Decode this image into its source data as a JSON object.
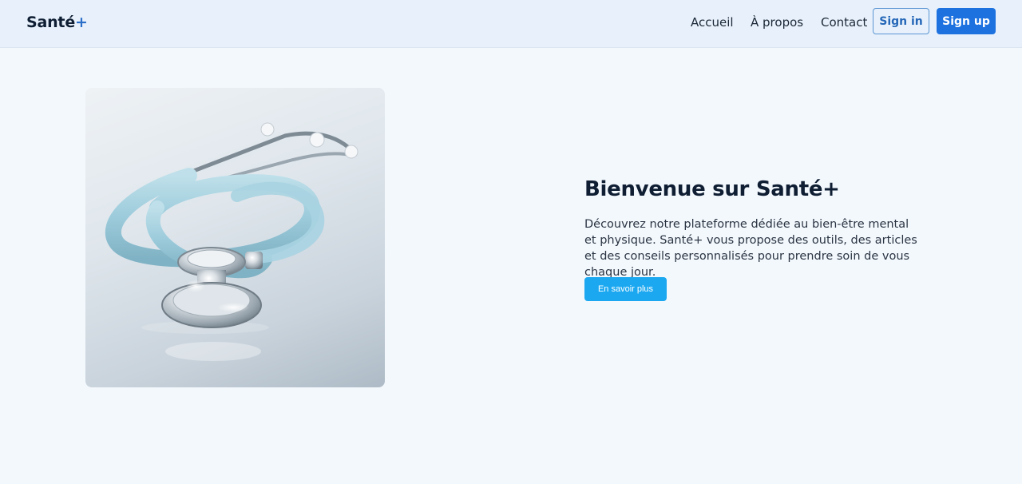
{
  "navbar": {
    "brand_name": "Santé",
    "brand_plus": "+",
    "links": [
      {
        "label": "Accueil"
      },
      {
        "label": "À propos"
      },
      {
        "label": "Contact"
      }
    ],
    "sign_in_label": "Sign in",
    "sign_up_label": "Sign up"
  },
  "hero": {
    "image_subject": "stethoscope",
    "title": "Bienvenue sur Santé+",
    "description": "Découvrez notre plateforme dédiée au bien-être mental et physique. Santé+ vous propose des outils, des articles et des conseils personnalisés pour prendre soin de vous chaque jour.",
    "cta_label": "En savoir plus"
  },
  "colors": {
    "page_background": "#f3f8fd",
    "navbar_background": "#e8f1fb",
    "primary": "#1d72e0",
    "cta": "#1ba8f0",
    "brand_accent": "#2b6fc8"
  }
}
